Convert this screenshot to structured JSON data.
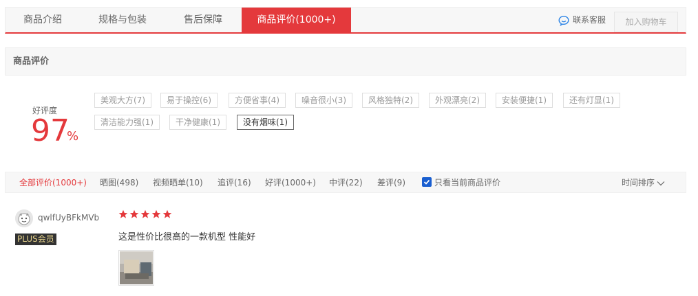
{
  "tabs": [
    {
      "label": "商品介绍"
    },
    {
      "label": "规格与包装"
    },
    {
      "label": "售后保障"
    },
    {
      "label": "商品评价(1000+)",
      "active": true
    }
  ],
  "header": {
    "contact_label": "联系客服",
    "add_cart_label": "加入购物车"
  },
  "section": {
    "title": "商品评价"
  },
  "rating": {
    "label": "好评度",
    "value": "97",
    "unit": "%"
  },
  "tags": [
    "美观大方(7)",
    "易于操控(6)",
    "方便省事(4)",
    "噪音很小(3)",
    "风格独特(2)",
    "外观漂亮(2)",
    "安装便捷(1)",
    "还有灯显(1)",
    "清洁能力强(1)",
    "干净健康(1)",
    "没有烟味(1)"
  ],
  "filters": {
    "items": [
      {
        "label": "全部评价(1000+)",
        "active": true
      },
      {
        "label": "晒图(498)"
      },
      {
        "label": "视频晒单(10)"
      },
      {
        "label": "追评(16)"
      },
      {
        "label": "好评(1000+)"
      },
      {
        "label": "中评(22)"
      },
      {
        "label": "差评(9)"
      }
    ],
    "only_current_label": "只看当前商品评价",
    "only_current_checked": true,
    "sort_label": "时间排序"
  },
  "comment": {
    "username": "qwlfUyBFkMVb",
    "badge": "PLUS会员",
    "stars": 5,
    "text": "这是性价比很高的一款机型 性能好"
  },
  "colors": {
    "accent": "#e4393c",
    "checkbox": "#1a5fd0"
  }
}
